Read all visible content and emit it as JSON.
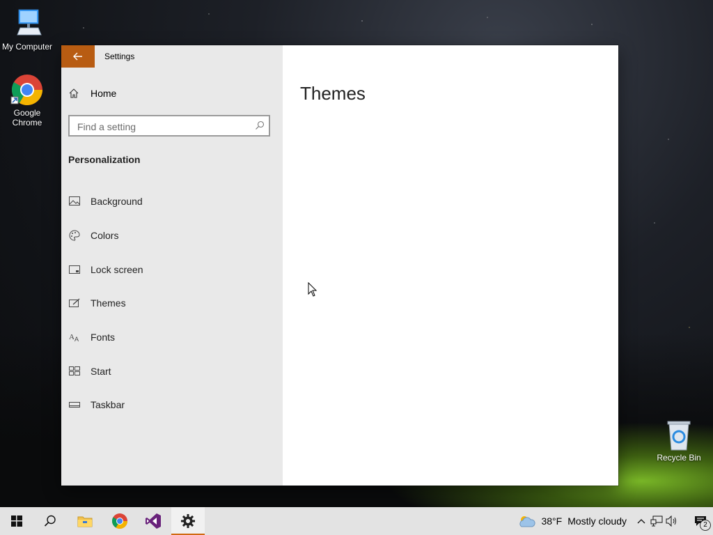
{
  "desktop": {
    "icons": [
      {
        "label": "My Computer"
      },
      {
        "label": "Google Chrome"
      },
      {
        "label": "Recycle Bin"
      }
    ]
  },
  "window": {
    "title": "Settings",
    "home_label": "Home",
    "search_placeholder": "Find a setting",
    "section_title": "Personalization",
    "nav_items": [
      {
        "label": "Background",
        "icon": "image-icon"
      },
      {
        "label": "Colors",
        "icon": "palette-icon"
      },
      {
        "label": "Lock screen",
        "icon": "lock-screen-icon"
      },
      {
        "label": "Themes",
        "icon": "themes-icon"
      },
      {
        "label": "Fonts",
        "icon": "fonts-icon"
      },
      {
        "label": "Start",
        "icon": "start-icon"
      },
      {
        "label": "Taskbar",
        "icon": "taskbar-icon"
      }
    ],
    "page_title": "Themes",
    "accent_color": "#b85c12"
  },
  "taskbar": {
    "apps": [
      "start",
      "search",
      "file-explorer",
      "chrome",
      "visual-studio",
      "settings"
    ],
    "weather_temp": "38°F",
    "weather_desc": "Mostly cloudy",
    "notification_count": "2"
  }
}
